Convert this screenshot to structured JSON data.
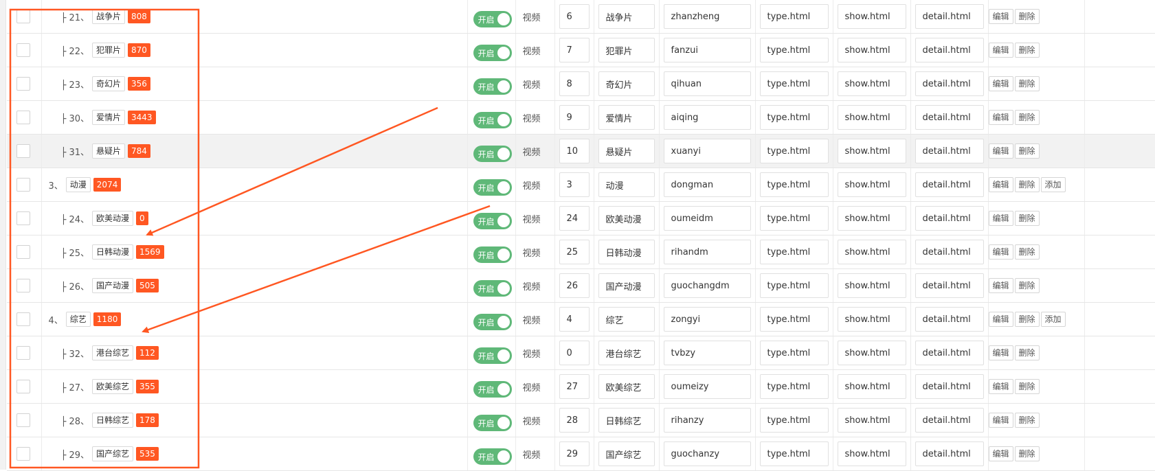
{
  "status_label": "开启",
  "module_label": "视频",
  "actions": {
    "edit": "编辑",
    "delete": "删除",
    "add": "添加"
  },
  "colors": {
    "annotation": "#ff5722",
    "count_badge": "#ff5722",
    "switch_on": "#5fb878"
  },
  "rows": [
    {
      "prefix": "├ 21、",
      "name": "战争片",
      "count": "808",
      "sort": "6",
      "ename": "zhanzheng",
      "list_tpl": "type.html",
      "show_tpl": "show.html",
      "detail_tpl": "detail.html",
      "level": "child"
    },
    {
      "prefix": "├ 22、",
      "name": "犯罪片",
      "count": "870",
      "sort": "7",
      "ename": "fanzui",
      "list_tpl": "type.html",
      "show_tpl": "show.html",
      "detail_tpl": "detail.html",
      "level": "child"
    },
    {
      "prefix": "├ 23、",
      "name": "奇幻片",
      "count": "356",
      "sort": "8",
      "ename": "qihuan",
      "list_tpl": "type.html",
      "show_tpl": "show.html",
      "detail_tpl": "detail.html",
      "level": "child"
    },
    {
      "prefix": "├ 30、",
      "name": "爱情片",
      "count": "3443",
      "sort": "9",
      "ename": "aiqing",
      "list_tpl": "type.html",
      "show_tpl": "show.html",
      "detail_tpl": "detail.html",
      "level": "child"
    },
    {
      "prefix": "├ 31、",
      "name": "悬疑片",
      "count": "784",
      "sort": "10",
      "ename": "xuanyi",
      "list_tpl": "type.html",
      "show_tpl": "show.html",
      "detail_tpl": "detail.html",
      "level": "child"
    },
    {
      "prefix": "3、",
      "name": "动漫",
      "count": "2074",
      "sort": "3",
      "ename": "dongman",
      "list_tpl": "type.html",
      "show_tpl": "show.html",
      "detail_tpl": "detail.html",
      "level": "parent"
    },
    {
      "prefix": "├ 24、",
      "name": "欧美动漫",
      "count": "0",
      "sort": "24",
      "ename": "oumeidm",
      "list_tpl": "type.html",
      "show_tpl": "show.html",
      "detail_tpl": "detail.html",
      "level": "child"
    },
    {
      "prefix": "├ 25、",
      "name": "日韩动漫",
      "count": "1569",
      "sort": "25",
      "ename": "rihandm",
      "list_tpl": "type.html",
      "show_tpl": "show.html",
      "detail_tpl": "detail.html",
      "level": "child"
    },
    {
      "prefix": "├ 26、",
      "name": "国产动漫",
      "count": "505",
      "sort": "26",
      "ename": "guochangdm",
      "list_tpl": "type.html",
      "show_tpl": "show.html",
      "detail_tpl": "detail.html",
      "level": "child"
    },
    {
      "prefix": "4、",
      "name": "综艺",
      "count": "1180",
      "sort": "4",
      "ename": "zongyi",
      "list_tpl": "type.html",
      "show_tpl": "show.html",
      "detail_tpl": "detail.html",
      "level": "parent"
    },
    {
      "prefix": "├ 32、",
      "name": "港台综艺",
      "count": "112",
      "sort": "0",
      "ename": "tvbzy",
      "list_tpl": "type.html",
      "show_tpl": "show.html",
      "detail_tpl": "detail.html",
      "level": "child"
    },
    {
      "prefix": "├ 27、",
      "name": "欧美综艺",
      "count": "355",
      "sort": "27",
      "ename": "oumeizy",
      "list_tpl": "type.html",
      "show_tpl": "show.html",
      "detail_tpl": "detail.html",
      "level": "child"
    },
    {
      "prefix": "├ 28、",
      "name": "日韩综艺",
      "count": "178",
      "sort": "28",
      "ename": "rihanzy",
      "list_tpl": "type.html",
      "show_tpl": "show.html",
      "detail_tpl": "detail.html",
      "level": "child"
    },
    {
      "prefix": "├ 29、",
      "name": "国产综艺",
      "count": "535",
      "sort": "29",
      "ename": "guochanzy",
      "list_tpl": "type.html",
      "show_tpl": "show.html",
      "detail_tpl": "detail.html",
      "level": "child"
    }
  ]
}
